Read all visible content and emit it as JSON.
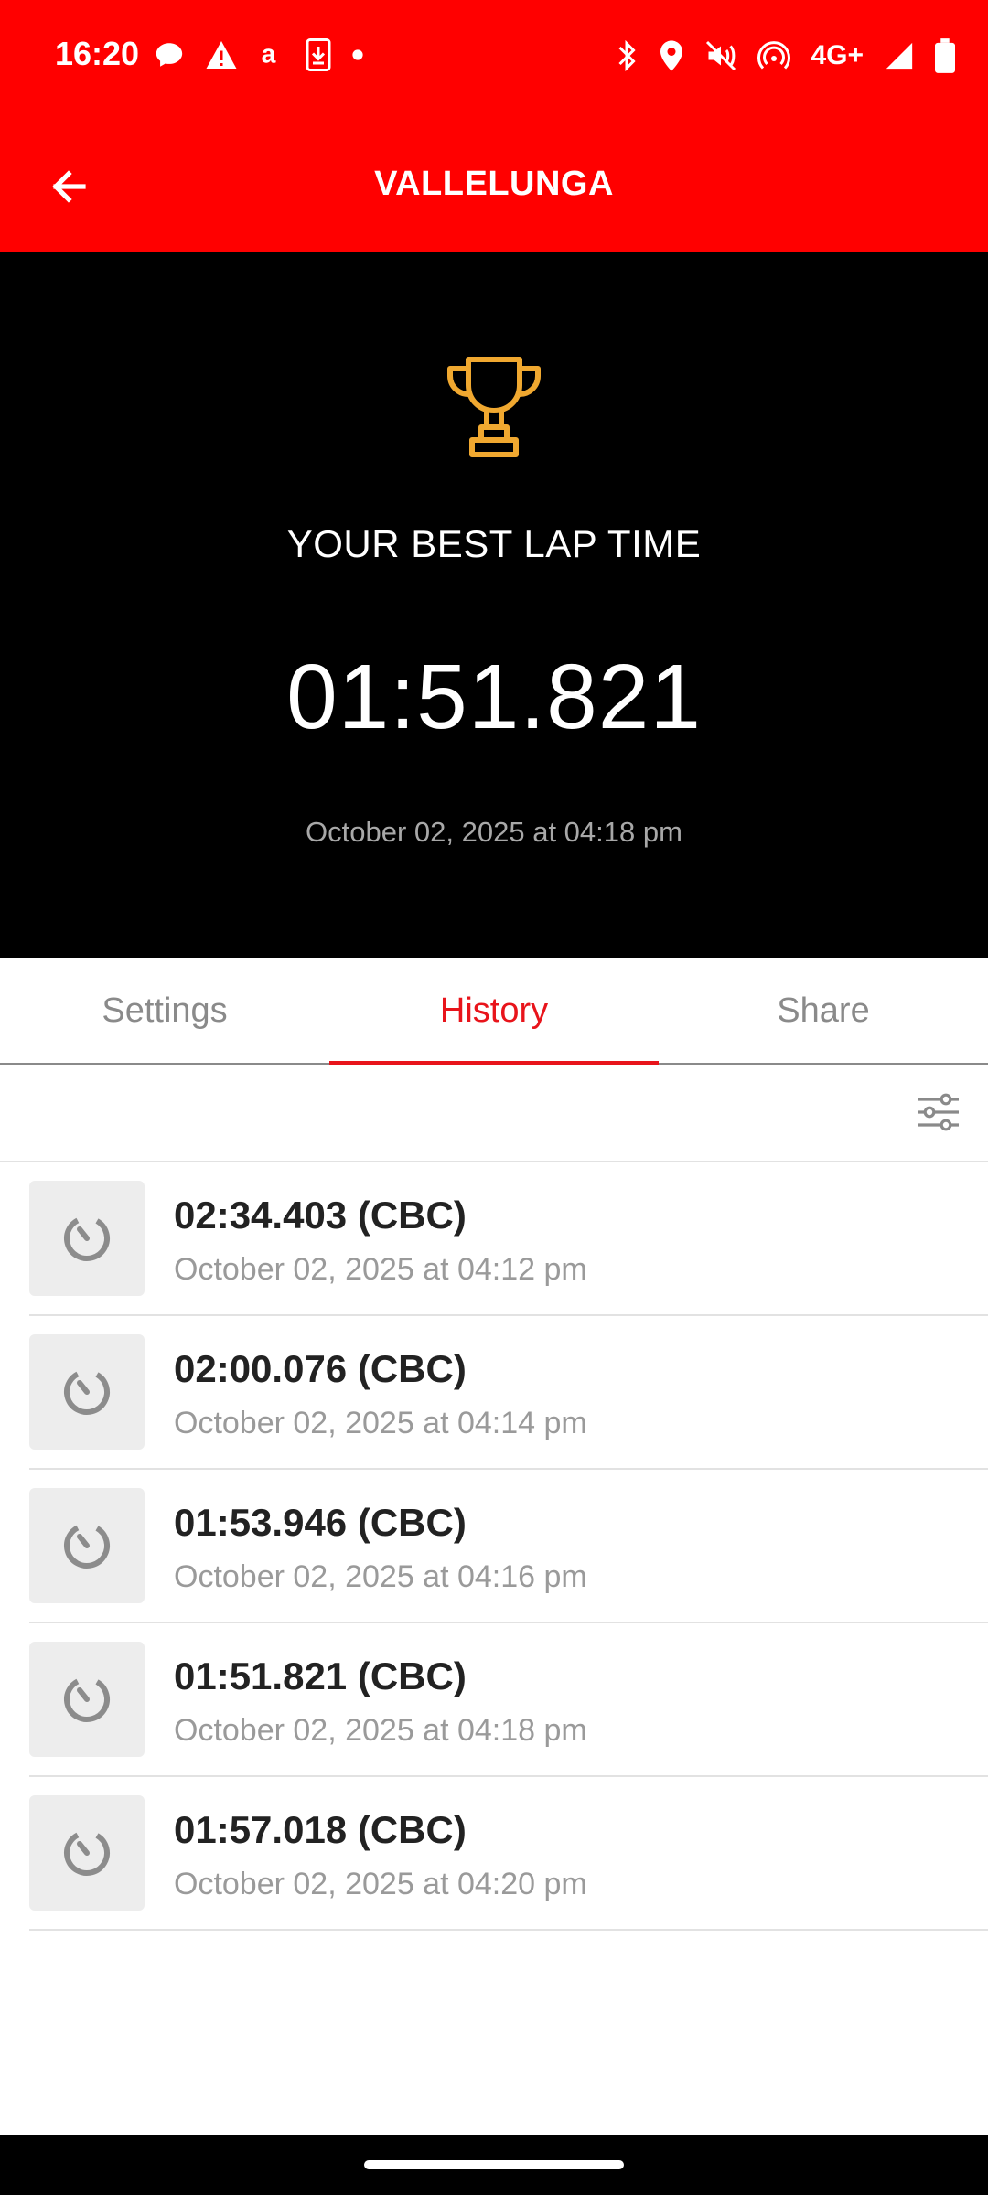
{
  "status_bar": {
    "time": "16:20",
    "network": "4G+",
    "left_icons": [
      "chat-bubble-icon",
      "warning-icon",
      "amazon-icon",
      "download-icon",
      "dot-icon"
    ],
    "right_icons": [
      "bluetooth-icon",
      "location-icon",
      "mute-icon",
      "hotspot-icon",
      "signal-icon",
      "battery-icon"
    ]
  },
  "app_bar": {
    "title": "VALLELUNGA",
    "back_icon": "back-arrow-icon"
  },
  "hero": {
    "icon": "trophy-icon",
    "label": "YOUR BEST LAP TIME",
    "best_time": "01:51.821",
    "date": "October 02, 2025 at 04:18 pm"
  },
  "tabs": [
    {
      "label": "Settings",
      "active": false
    },
    {
      "label": "History",
      "active": true
    },
    {
      "label": "Share",
      "active": false
    }
  ],
  "filter_icon": "filter-sliders-icon",
  "laps": [
    {
      "time": "02:34.403 (CBC)",
      "date": "October 02, 2025 at 04:12 pm"
    },
    {
      "time": "02:00.076 (CBC)",
      "date": "October 02, 2025 at 04:14 pm"
    },
    {
      "time": "01:53.946 (CBC)",
      "date": "October 02, 2025 at 04:16 pm"
    },
    {
      "time": "01:51.821 (CBC)",
      "date": "October 02, 2025 at 04:18 pm"
    },
    {
      "time": "01:57.018 (CBC)",
      "date": "October 02, 2025 at 04:20 pm"
    }
  ],
  "colors": {
    "brand_red": "#ff0000",
    "accent": "#e8141b",
    "trophy": "#f0a830",
    "hero_bg": "#000000"
  }
}
